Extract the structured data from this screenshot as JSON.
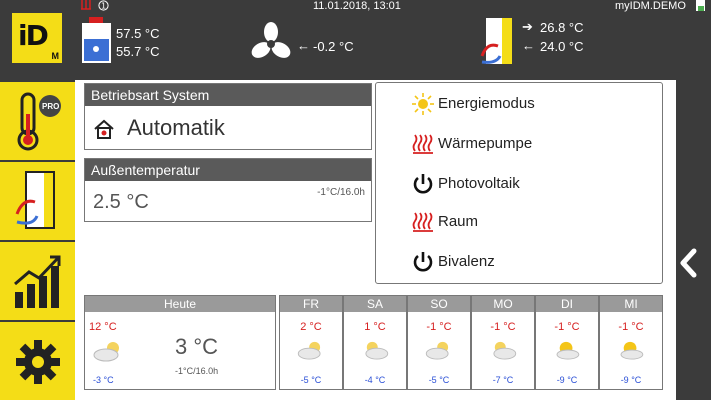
{
  "header": {
    "datetime": "11.01.2018, 13:01",
    "user": "myIDM.DEMO",
    "logo_text": "iD",
    "logo_sub": "M",
    "boiler_top": "57.5 °C",
    "boiler_bottom": "55.7 °C",
    "fan_temp": "-0.2 °C",
    "heating_out": "26.8 °C",
    "heating_in": "24.0 °C"
  },
  "sidebar": {
    "items": [
      {
        "name": "thermometer-pro"
      },
      {
        "name": "heatpump"
      },
      {
        "name": "statistics"
      },
      {
        "name": "settings"
      }
    ],
    "pro_label": "PRO"
  },
  "system_mode": {
    "title": "Betriebsart System",
    "value": "Automatik"
  },
  "outside_temp": {
    "title": "Außentemperatur",
    "value": "2.5 °C",
    "trend": "-1°C/16.0h"
  },
  "modes": [
    {
      "label": "Energiemodus",
      "icon": "sun-icon"
    },
    {
      "label": "Wärmepumpe",
      "icon": "heat-icon"
    },
    {
      "label": "Photovoltaik",
      "icon": "power-icon"
    },
    {
      "label": "Raum",
      "icon": "heat-icon"
    },
    {
      "label": "Bivalenz",
      "icon": "power-icon"
    }
  ],
  "today": {
    "label": "Heute",
    "hi": "12 °C",
    "lo": "-3 °C",
    "current": "3 °C",
    "trend": "-1°C/16.0h"
  },
  "forecast": [
    {
      "day": "FR",
      "hi": "2 °C",
      "lo": "-5 °C"
    },
    {
      "day": "SA",
      "hi": "1 °C",
      "lo": "-4 °C"
    },
    {
      "day": "SO",
      "hi": "-1 °C",
      "lo": "-5 °C"
    },
    {
      "day": "MO",
      "hi": "-1 °C",
      "lo": "-7 °C"
    },
    {
      "day": "DI",
      "hi": "-1 °C",
      "lo": "-9 °C"
    },
    {
      "day": "MI",
      "hi": "-1 °C",
      "lo": "-9 °C"
    }
  ],
  "colors": {
    "accent": "#f4dd17",
    "dark": "#3b3b3b",
    "hot": "#d62020",
    "cold": "#2a4fd6"
  }
}
